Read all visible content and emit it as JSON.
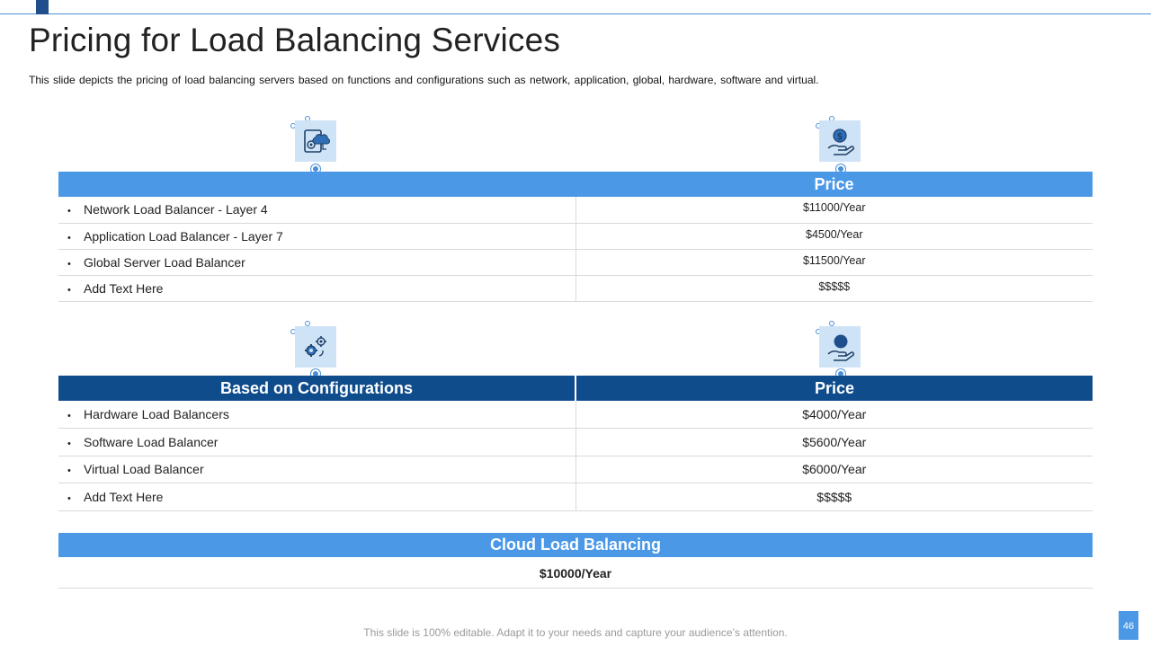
{
  "slide": {
    "title": "Pricing for Load Balancing Services",
    "subtitle": "This slide depicts the pricing of load balancing servers based on functions and configurations such as network, application, global, hardware, software and virtual.",
    "footer": "This slide is 100% editable. Adapt it to your needs and capture your audience’s attention.",
    "page_number": "46"
  },
  "icons": [
    "cloud-document-icon",
    "dollar-hand-icon",
    "gears-icon",
    "coin-hand-icon"
  ],
  "colors": {
    "accent_light": "#4a98e6",
    "accent_dark": "#0f4c8c",
    "icon_bg": "#cfe3f7"
  },
  "functions_table": {
    "headers": [
      "",
      "Price"
    ],
    "rows": [
      {
        "item": "Network Load Balancer - Layer 4",
        "price": "$11000/Year"
      },
      {
        "item": "Application Load Balancer - Layer 7",
        "price": "$4500/Year"
      },
      {
        "item": "Global Server Load Balancer",
        "price": "$11500/Year"
      },
      {
        "item": "Add Text Here",
        "price": "$$$$$"
      }
    ]
  },
  "config_table": {
    "headers": [
      "Based on Configurations",
      "Price"
    ],
    "rows": [
      {
        "item": "Hardware Load Balancers",
        "price": "$4000/Year"
      },
      {
        "item": "Software Load Balancer",
        "price": "$5600/Year"
      },
      {
        "item": "Virtual Load Balancer",
        "price": "$6000/Year"
      },
      {
        "item": "Add Text Here",
        "price": "$$$$$"
      }
    ]
  },
  "cloud": {
    "header": "Cloud Load Balancing",
    "price": "$10000/Year"
  }
}
